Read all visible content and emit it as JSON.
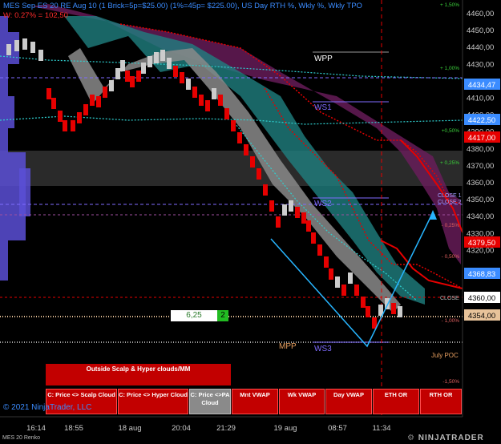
{
  "header": {
    "line1": "MES Sep ES 20 RE Aug 10 (1 Brick=5p=$25.00) (1%=45p= $225.00), US Day RTH %, Wkly %, Wkly TPO",
    "line2": "W: 0.27% = 102,50"
  },
  "x_axis": [
    "16:14",
    "18:55",
    "18 aug",
    "20:04",
    "21:29",
    "19 aug",
    "08:57",
    "11:34"
  ],
  "y_axis": [
    "4460,00",
    "4450,00",
    "4440,00",
    "4430,00",
    "4420,00",
    "4410,00",
    "4400,00",
    "4390,00",
    "4380,00",
    "4370,00",
    "4360,00",
    "4350,00",
    "4340,00",
    "4330,00",
    "4320,00"
  ],
  "price_tags": [
    {
      "label": "4434,47",
      "color": "#3b8cff"
    },
    {
      "label": "4422,50",
      "color": "#3b8cff"
    },
    {
      "label": "4417,00",
      "color": "#e60000"
    },
    {
      "label": "4379,50",
      "color": "#e60000"
    },
    {
      "label": "4368,83",
      "color": "#3b8cff"
    },
    {
      "label": "4360,00",
      "color": "#ffffff"
    },
    {
      "label": "4354,00",
      "color": "#e8c39a"
    }
  ],
  "pct_labels": [
    "+ 1,50%",
    "+ 1,00%",
    "+0,50%",
    "+ 0,25%",
    "- 0,25%",
    "- 0,50%",
    "- 1,00%",
    "-1,50%"
  ],
  "levels": {
    "wpp": "WPP",
    "ws1": "WS1",
    "ws2": "WS2",
    "ws3": "WS3",
    "mpp": "MPP",
    "close1": "CLOSE 1",
    "close2": "CLOSE 2",
    "close": "CLOSE",
    "july_poc": "July POC"
  },
  "input": {
    "value": "6,25",
    "qty": "2"
  },
  "banner": "Outside Scalp & Hyper clouds/MM",
  "buttons": [
    {
      "label": "C: Price <> Scalp Cloud",
      "style": "red"
    },
    {
      "label": "C: Price <> Hyper Cloud",
      "style": "red"
    },
    {
      "label": "C: Price <>PA Cloud",
      "style": "gray"
    },
    {
      "label": "Mnt VWAP",
      "style": "red"
    },
    {
      "label": "Wk VWAP",
      "style": "red"
    },
    {
      "label": "Day VWAP",
      "style": "red"
    },
    {
      "label": "ETH OR",
      "style": "red"
    },
    {
      "label": "RTH OR",
      "style": "red"
    }
  ],
  "copyright": "© 2021 NinjaTrader, LLC",
  "instrument": "MES 20 Renko",
  "brand": "NINJATRADER",
  "colors": {
    "up": "#cccccc",
    "down": "#e60000",
    "accent": "#3b8cff"
  }
}
